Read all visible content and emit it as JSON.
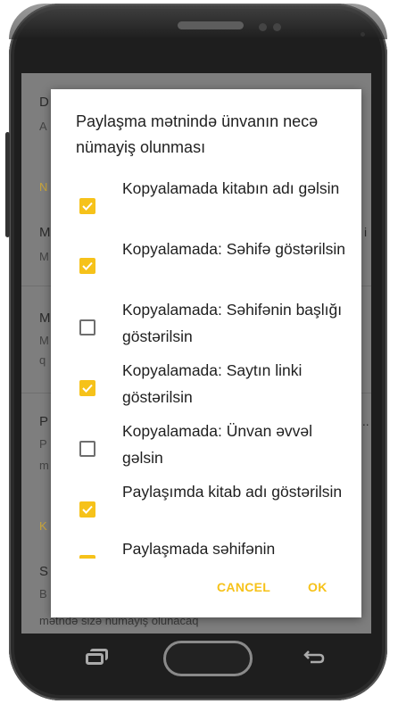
{
  "background_screen": {
    "rows": [
      {
        "letter": "D",
        "sub": "A"
      },
      {
        "letter": "N",
        "sub": ""
      },
      {
        "letter": "M",
        "sub": "M",
        "trail": "i"
      },
      {
        "letter": "M",
        "sub": "M",
        "sub2": "q"
      },
      {
        "letter": "P",
        "sub": "P",
        "sub2": "m",
        "trail": "..."
      },
      {
        "letter": "K",
        "sub": ""
      },
      {
        "letter": "S",
        "sub": "B"
      }
    ],
    "bottom_text": "mətndə sizə nümayiş olunacaq"
  },
  "dialog": {
    "title": "Paylaşma mətnində ünvanın necə nümayiş olunması",
    "items": [
      {
        "label": "Kopyalamada kitabın adı gəlsin",
        "checked": true
      },
      {
        "label": "Kopyalamada: Səhifə göstərilsin",
        "checked": true
      },
      {
        "label": "Kopyalamada: Səhifənin başlığı göstərilsin",
        "checked": false
      },
      {
        "label": "Kopyalamada: Saytın linki göstərilsin",
        "checked": true
      },
      {
        "label": "Kopyalamada: Ünvan əvvəl gəlsin",
        "checked": false
      },
      {
        "label": "Paylaşımda kitab adı göstərilsin",
        "checked": true
      },
      {
        "label": "Paylaşmada səhifənin",
        "checked": true
      }
    ],
    "cancel_label": "CANCEL",
    "ok_label": "OK"
  },
  "colors": {
    "accent": "#f6c21a",
    "overlay": "#7e7e7e",
    "phone_body": "#1e1e1e"
  },
  "icons": {
    "checkbox_checked": "check-icon",
    "nav_recent": "recent-apps-icon",
    "nav_back": "back-arrow-icon"
  }
}
